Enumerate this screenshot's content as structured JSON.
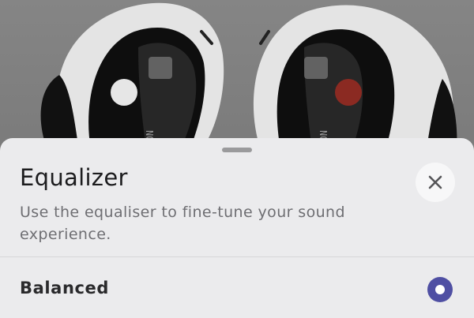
{
  "sheet": {
    "title": "Equalizer",
    "description": "Use the equaliser to fine-tune your sound experience.",
    "close_icon": "close-icon"
  },
  "options": [
    {
      "label": "Balanced",
      "selected": true
    }
  ],
  "colors": {
    "accent": "#4f4fa3",
    "sheet_background": "#ebebed",
    "right_earbud_dot": "#8b2a22",
    "left_earbud_dot": "#e6e6e6"
  }
}
